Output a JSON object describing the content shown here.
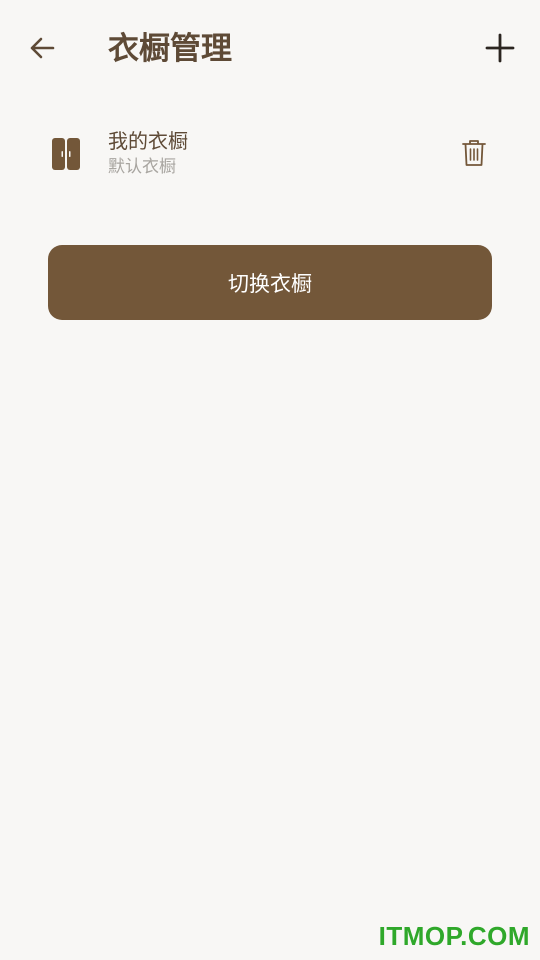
{
  "header": {
    "title": "衣橱管理",
    "back_icon": "arrow-left-icon",
    "add_icon": "plus-icon"
  },
  "wardrobes": [
    {
      "name": "我的衣橱",
      "subtitle": "默认衣橱",
      "icon": "wardrobe-icon",
      "delete_icon": "trash-icon"
    }
  ],
  "actions": {
    "switch_label": "切换衣橱"
  },
  "watermark": "ITMOP.COM",
  "colors": {
    "background": "#f8f7f5",
    "primary": "#735739",
    "text_primary": "#5e4a36",
    "text_secondary": "#a8a5a0",
    "watermark": "#2fa82a"
  }
}
